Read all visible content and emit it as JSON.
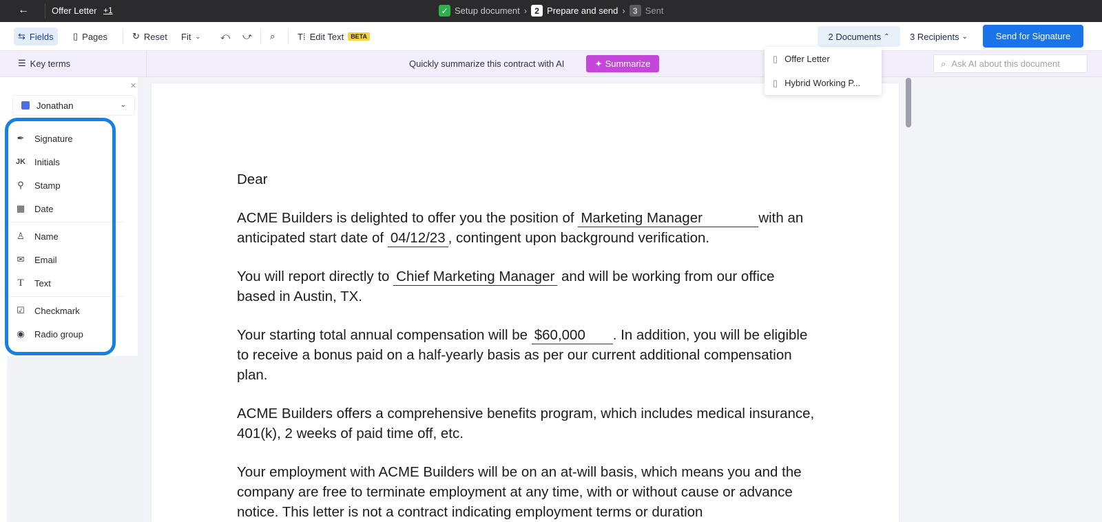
{
  "topbar": {
    "back_icon": "←",
    "doc_title": "Offer Letter",
    "doc_more": "+1",
    "steps": [
      {
        "marker": "✓",
        "label": "Setup document"
      },
      {
        "marker": "2",
        "label": "Prepare and send"
      },
      {
        "marker": "3",
        "label": "Sent"
      }
    ]
  },
  "toolbar": {
    "fields": "Fields",
    "pages": "Pages",
    "reset": "Reset",
    "fit": "Fit",
    "edit_text": "Edit Text",
    "beta": "BETA",
    "documents": "2 Documents",
    "recipients": "3 Recipients",
    "send": "Send for Signature"
  },
  "aibar": {
    "key_terms": "Key terms",
    "prompt": "Quickly summarize this contract with AI",
    "summarize": "Summarize",
    "ask_placeholder": "Ask AI about this document"
  },
  "documents_menu": [
    {
      "label": "Offer Letter"
    },
    {
      "label": "Hybrid Working P..."
    }
  ],
  "sidebar": {
    "recipient": "Jonathan",
    "recipient_color": "#4c6fe8",
    "fields": [
      {
        "label": "Signature",
        "icon": "pen-icon"
      },
      {
        "label": "Initials",
        "icon": "initials-icon"
      },
      {
        "label": "Stamp",
        "icon": "stamp-icon"
      },
      {
        "label": "Date",
        "icon": "calendar-icon"
      },
      {
        "label": "Name",
        "icon": "person-icon"
      },
      {
        "label": "Email",
        "icon": "envelope-icon"
      },
      {
        "label": "Text",
        "icon": "text-icon"
      },
      {
        "label": "Checkmark",
        "icon": "checkbox-icon"
      },
      {
        "label": "Radio group",
        "icon": "radio-icon"
      }
    ]
  },
  "letter": {
    "greeting": "Dear",
    "p1_a": "ACME Builders is delighted to offer you the position of",
    "position": "Marketing Manager",
    "p1_b": "with an anticipated start date of",
    "start_date": "04/12/23",
    "p1_c": ", contingent upon background verification.",
    "p2_a": "You will report directly to",
    "manager": "Chief Marketing Manager",
    "p2_b": "and will be working from our office based in Austin, TX.",
    "p3_a": "Your starting total annual compensation will be",
    "salary": "$60,000",
    "p3_b": ". In addition, you will be eligible to receive a bonus paid on a half-yearly basis as per our current additional compensation plan.",
    "p4": "ACME Builders offers a comprehensive benefits program, which includes medical insurance, 401(k), 2 weeks of paid time off, etc.",
    "p5": "Your employment with ACME Builders will be on an at-will basis, which means you and the company are free to terminate employment at any time, with or without cause or advance notice. This letter is not a contract indicating employment terms or duration"
  },
  "colors": {
    "accent": "#1a73e8",
    "highlight": "#1580e6",
    "summarize": "#c447d9"
  }
}
